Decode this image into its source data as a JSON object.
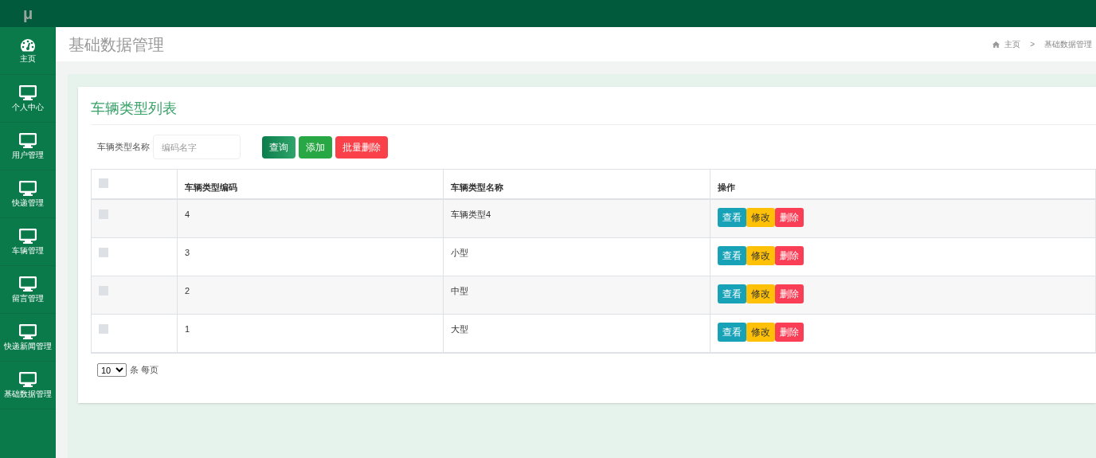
{
  "logo": "μ",
  "sidebar": {
    "items": [
      {
        "label": "主页",
        "kind": "dashboard",
        "selected": false
      },
      {
        "label": "个人中心",
        "kind": "monitor",
        "selected": false
      },
      {
        "label": "用户管理",
        "kind": "monitor",
        "selected": false
      },
      {
        "label": "快递管理",
        "kind": "monitor",
        "selected": false
      },
      {
        "label": "车辆管理",
        "kind": "monitor",
        "selected": false
      },
      {
        "label": "留言管理",
        "kind": "monitor",
        "selected": false
      },
      {
        "label": "快递新闻管理",
        "kind": "monitor",
        "selected": false
      },
      {
        "label": "基础数据管理",
        "kind": "monitor",
        "selected": false
      }
    ]
  },
  "page_title": "基础数据管理",
  "breadcrumb": [
    "主页",
    "基础数据管理"
  ],
  "breadcrumb_separator": ">",
  "card": {
    "title": "车辆类型列表",
    "search": {
      "label": "车辆类型名称",
      "placeholder": "编码名字"
    },
    "buttons": [
      {
        "label": "查询",
        "kind": "query"
      },
      {
        "label": "添加",
        "kind": "add"
      },
      {
        "label": "批量删除",
        "kind": "delete"
      }
    ],
    "table": {
      "select_all_checked": false,
      "columns": [
        "车辆类型编码",
        "车辆类型名称",
        "操作"
      ],
      "rows": [
        {
          "checked": false,
          "cells": [
            "4",
            "车辆类型4"
          ],
          "actions": [
            {
              "label": "查看",
              "kind": "view"
            },
            {
              "label": "修改",
              "kind": "edit"
            },
            {
              "label": "删除",
              "kind": "delete"
            }
          ]
        },
        {
          "checked": false,
          "cells": [
            "3",
            "小型"
          ],
          "actions": [
            {
              "label": "查看",
              "kind": "view"
            },
            {
              "label": "修改",
              "kind": "edit"
            },
            {
              "label": "删除",
              "kind": "delete"
            }
          ]
        },
        {
          "checked": false,
          "cells": [
            "2",
            "中型"
          ],
          "actions": [
            {
              "label": "查看",
              "kind": "view"
            },
            {
              "label": "修改",
              "kind": "edit"
            },
            {
              "label": "删除",
              "kind": "delete"
            }
          ]
        },
        {
          "checked": false,
          "cells": [
            "1",
            "大型"
          ],
          "actions": [
            {
              "label": "查看",
              "kind": "view"
            },
            {
              "label": "修改",
              "kind": "edit"
            },
            {
              "label": "删除",
              "kind": "delete"
            }
          ]
        }
      ]
    },
    "page_size": {
      "value": "10",
      "suffix": "条 每页"
    }
  }
}
